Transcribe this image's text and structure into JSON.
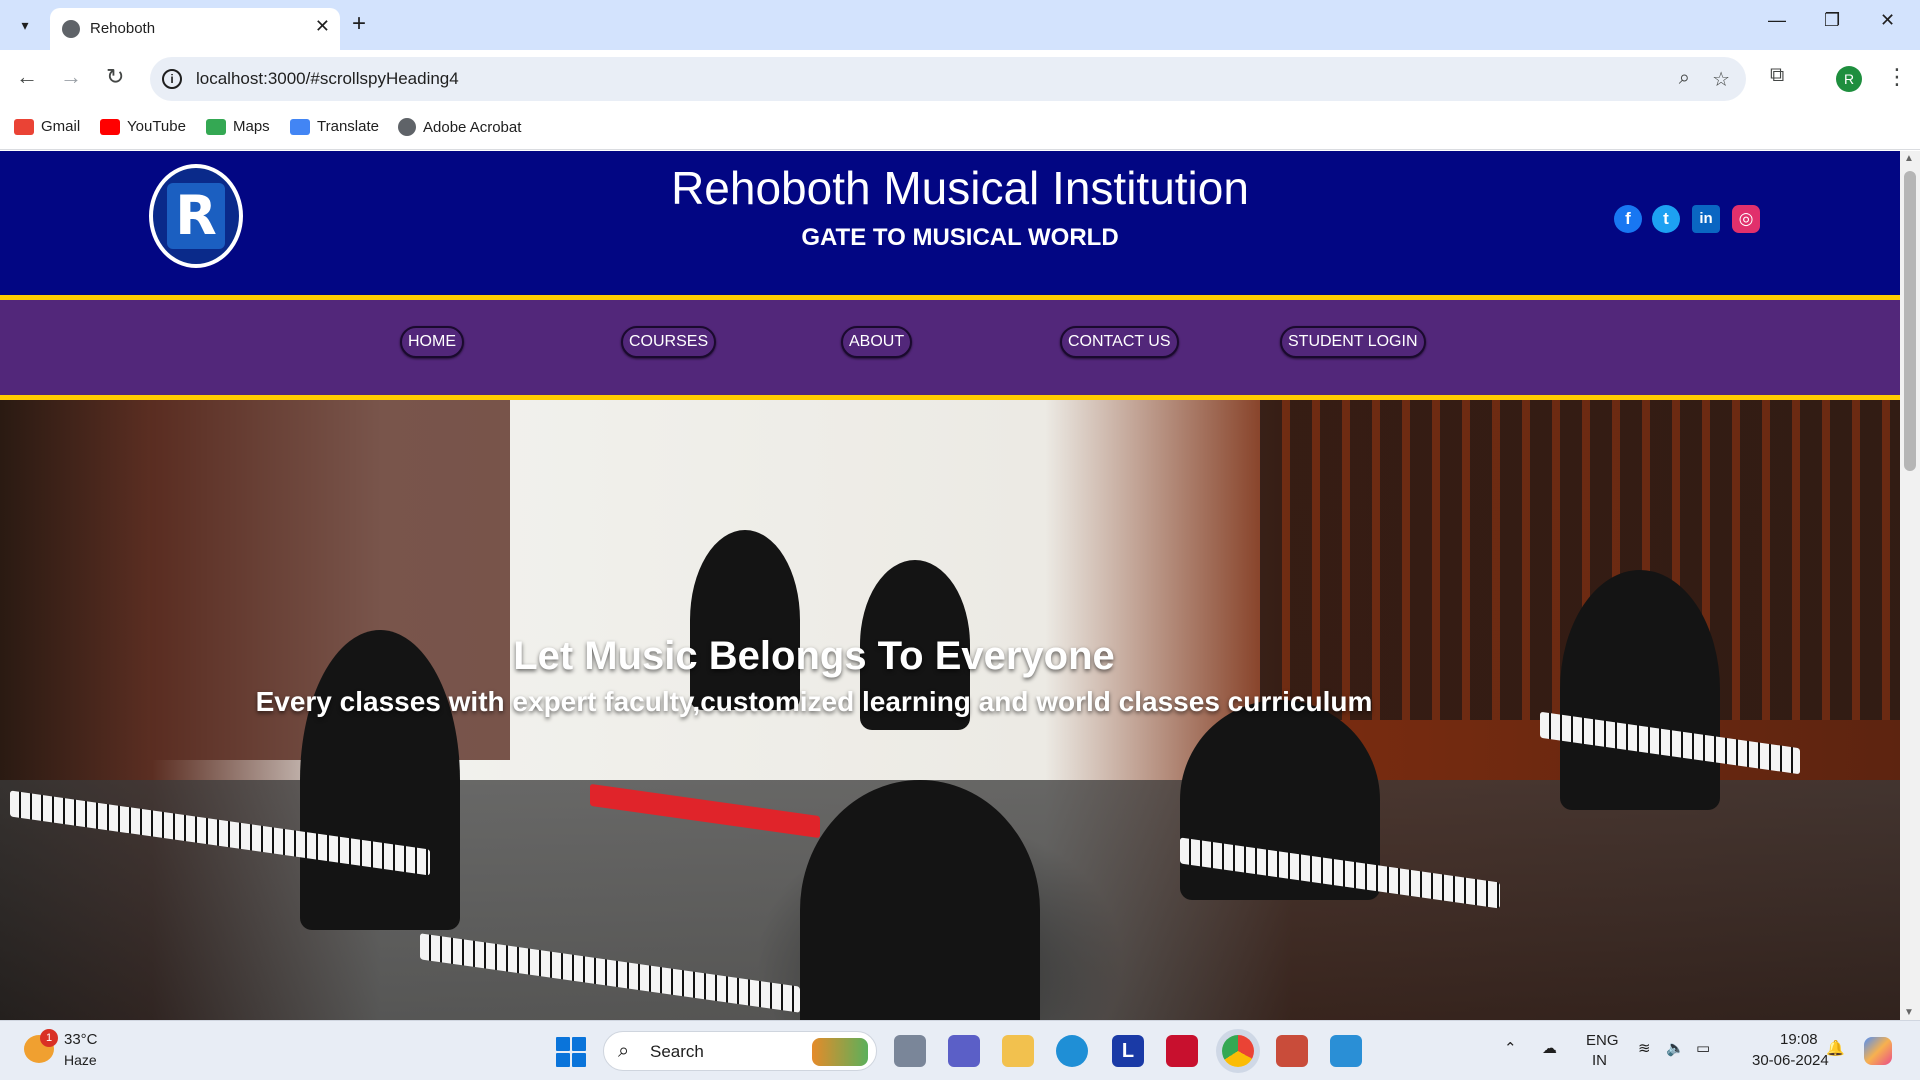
{
  "browser": {
    "tab_title": "Rehoboth",
    "url": "localhost:3000/#scrollspyHeading4",
    "profile_initial": "R",
    "bookmarks": [
      {
        "label": "Gmail",
        "icon": "gmail-icon",
        "color": "#ea4335"
      },
      {
        "label": "YouTube",
        "icon": "youtube-icon",
        "color": "#ff0000"
      },
      {
        "label": "Maps",
        "icon": "maps-icon",
        "color": "#34a853"
      },
      {
        "label": "Translate",
        "icon": "translate-icon",
        "color": "#4285f4"
      },
      {
        "label": "Adobe Acrobat",
        "icon": "globe-icon",
        "color": "#5f6368"
      }
    ]
  },
  "site": {
    "title": "Rehoboth Musical Institution",
    "tagline": "GATE TO MUSICAL WORLD",
    "logo_letter": "R",
    "colors": {
      "header": "#020683",
      "navbar": "#52277a",
      "accent": "#ffcc00"
    },
    "social": [
      {
        "name": "facebook-icon",
        "glyph": "f",
        "color": "#1877f2"
      },
      {
        "name": "twitter-icon",
        "glyph": "t",
        "color": "#1da1f2"
      },
      {
        "name": "linkedin-icon",
        "glyph": "in",
        "color": "#0a66c2"
      },
      {
        "name": "instagram-icon",
        "glyph": "◎",
        "color": "#e1306c"
      }
    ],
    "nav": [
      "HOME",
      "COURSES",
      "ABOUT",
      "CONTACT US",
      "STUDENT LOGIN"
    ],
    "hero": {
      "heading": "Let Music Belongs To Everyone",
      "subheading": "Every classes with expert faculty,customized learning and world classes curriculum"
    }
  },
  "taskbar": {
    "weather_temp": "33°C",
    "weather_condition": "Haze",
    "weather_badge": "1",
    "search_label": "Search",
    "language": "ENG",
    "region": "IN",
    "time": "19:08",
    "date": "30-06-2024"
  }
}
